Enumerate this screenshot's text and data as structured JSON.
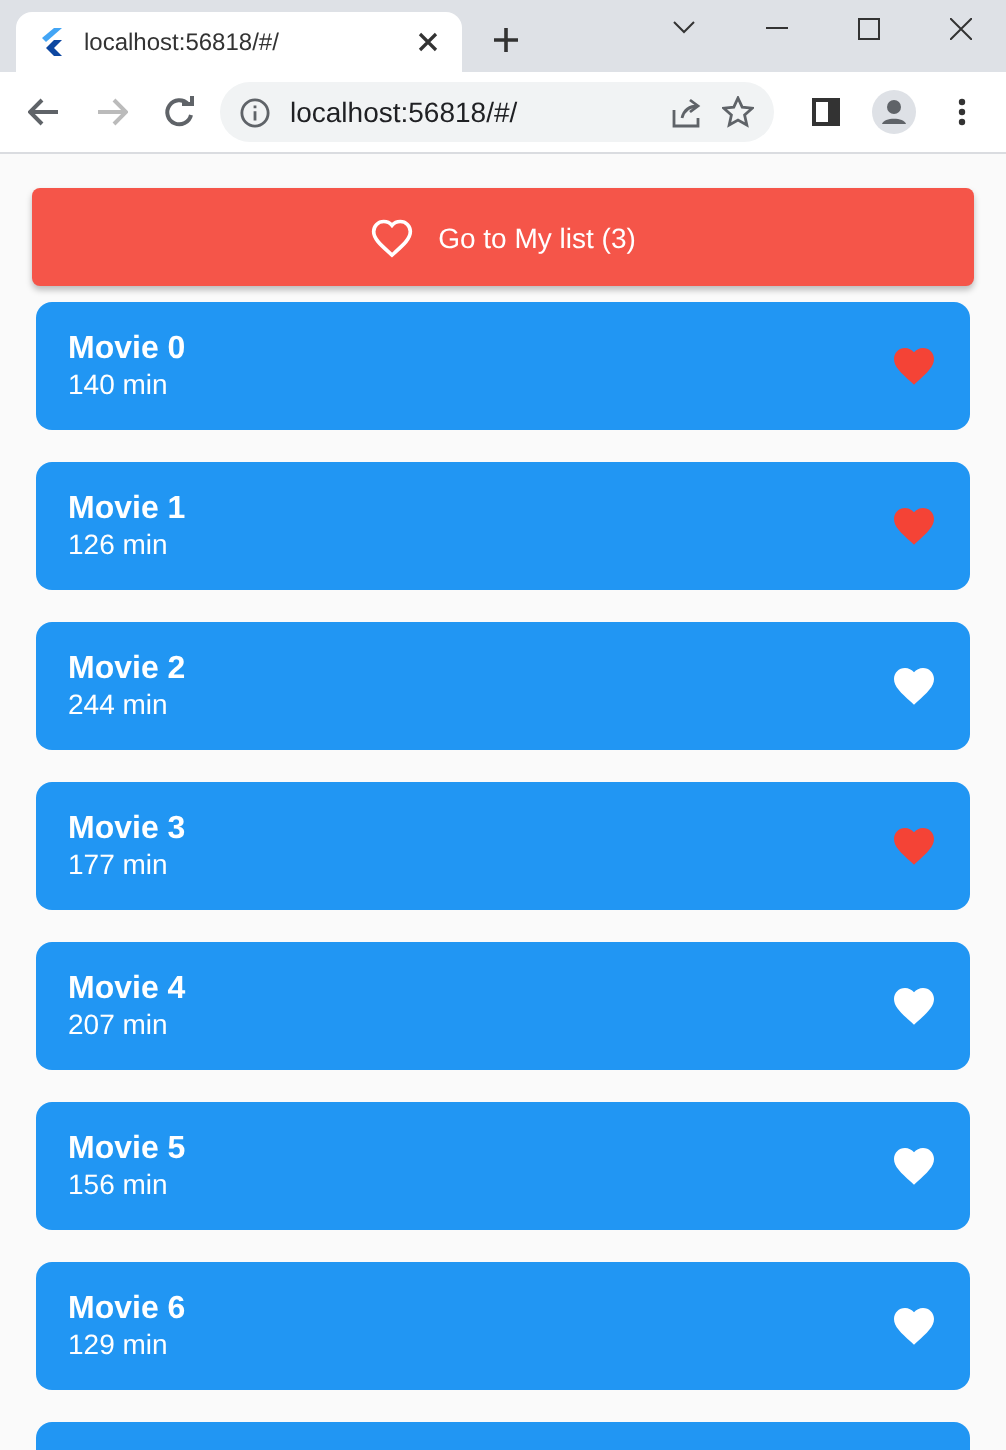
{
  "browser": {
    "tab_title": "localhost:56818/#/",
    "url": "localhost:56818/#/"
  },
  "my_list_button": {
    "label": "Go to My list (3)"
  },
  "movies": [
    {
      "title": "Movie 0",
      "duration": "140 min",
      "favorite": true
    },
    {
      "title": "Movie 1",
      "duration": "126 min",
      "favorite": true
    },
    {
      "title": "Movie 2",
      "duration": "244 min",
      "favorite": false
    },
    {
      "title": "Movie 3",
      "duration": "177 min",
      "favorite": true
    },
    {
      "title": "Movie 4",
      "duration": "207 min",
      "favorite": false
    },
    {
      "title": "Movie 5",
      "duration": "156 min",
      "favorite": false
    },
    {
      "title": "Movie 6",
      "duration": "129 min",
      "favorite": false
    }
  ]
}
